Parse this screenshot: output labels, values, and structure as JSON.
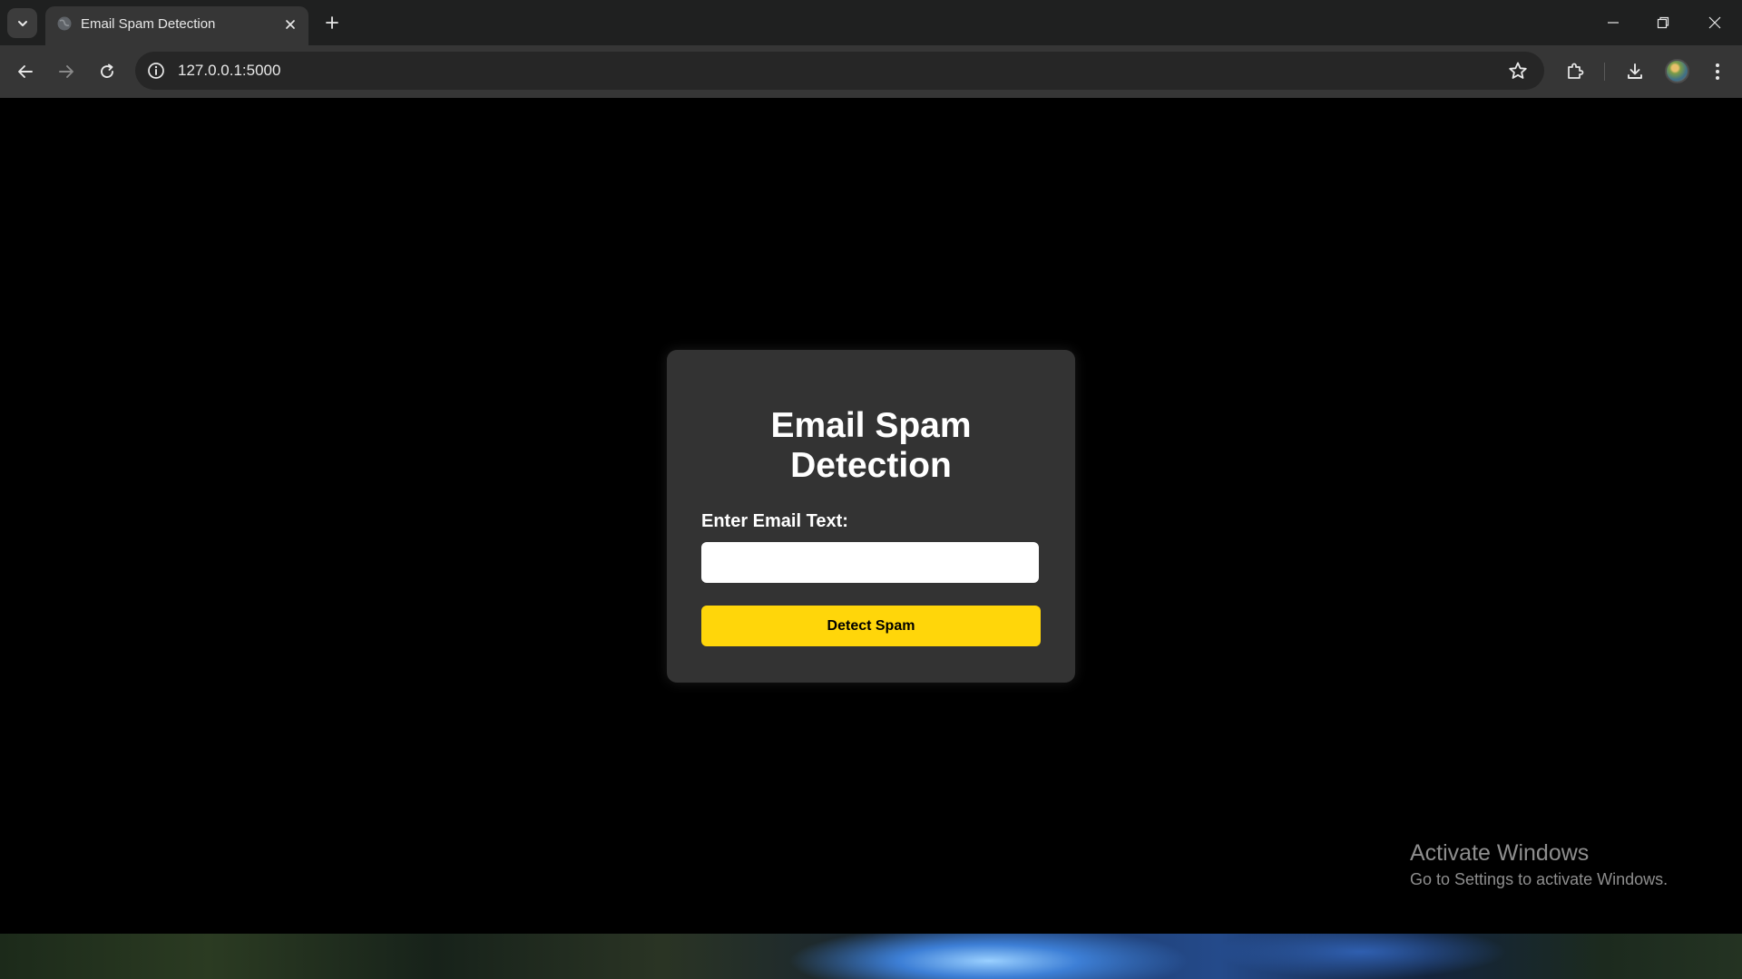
{
  "browser": {
    "tab": {
      "title": "Email Spam Detection"
    },
    "address_bar": {
      "url": "127.0.0.1:5000"
    },
    "icons": [
      "tab-search-icon",
      "globe-icon",
      "close-icon",
      "plus-icon",
      "minimize-icon",
      "restore-icon",
      "window-close-icon",
      "back-arrow-icon",
      "forward-arrow-icon",
      "reload-icon",
      "site-info-icon",
      "star-icon",
      "extensions-icon",
      "download-icon",
      "profile-avatar",
      "kebab-menu-icon"
    ]
  },
  "page": {
    "title": "Email Spam Detection",
    "form": {
      "label": "Enter Email Text:",
      "input_value": "",
      "button_label": "Detect Spam"
    },
    "colors": {
      "background": "#000000",
      "card": "#333333",
      "button": "#ffd60a",
      "text": "#ffffff"
    }
  },
  "watermark": {
    "title": "Activate Windows",
    "subtitle": "Go to Settings to activate Windows."
  }
}
